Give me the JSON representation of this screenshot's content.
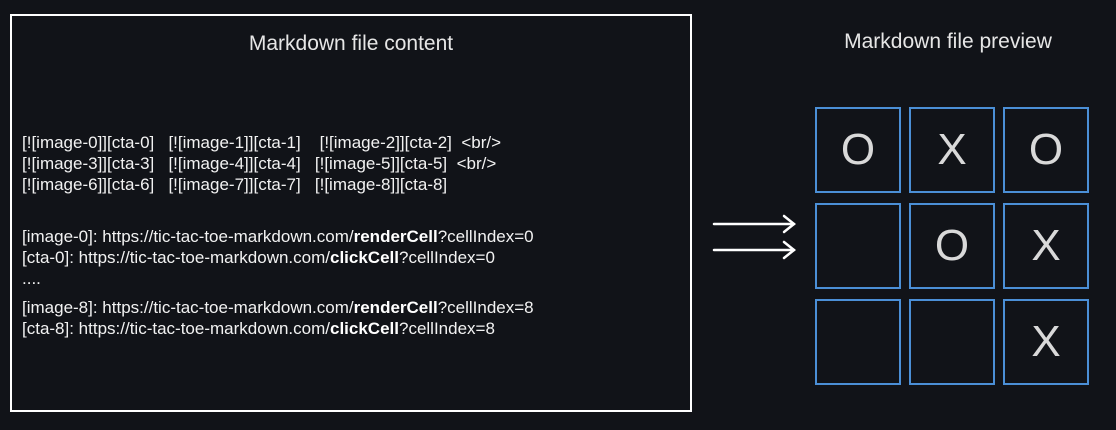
{
  "content_panel": {
    "title": "Markdown file content",
    "grid_lines": [
      "[![image-0]][cta-0]   [![image-1]][cta-1]    [![image-2]][cta-2]  <br/>",
      "[![image-3]][cta-3]   [![image-4]][cta-4]   [![image-5]][cta-5]  <br/>",
      "[![image-6]][cta-6]   [![image-7]][cta-7]   [![image-8]][cta-8]"
    ],
    "link_lines": [
      {
        "prefix": "[image-0]: https://tic-tac-toe-markdown.com/",
        "bold": "renderCell",
        "suffix": "?cellIndex=0"
      },
      {
        "prefix": "[cta-0]: https://tic-tac-toe-markdown.com/",
        "bold": "clickCell",
        "suffix": "?cellIndex=0"
      },
      {
        "prefix": "....",
        "bold": "",
        "suffix": ""
      },
      {
        "prefix": "[image-8]: https://tic-tac-toe-markdown.com/",
        "bold": "renderCell",
        "suffix": "?cellIndex=8"
      },
      {
        "prefix": "[cta-8]: https://tic-tac-toe-markdown.com/",
        "bold": "clickCell",
        "suffix": "?cellIndex=8"
      }
    ]
  },
  "preview": {
    "title": "Markdown file preview",
    "board": [
      "O",
      "X",
      "O",
      "",
      "O",
      "X",
      "",
      "",
      "X"
    ]
  },
  "colors": {
    "background": "#111318",
    "cell_border": "#4b8fd6",
    "mark": "#d9d9d9"
  }
}
